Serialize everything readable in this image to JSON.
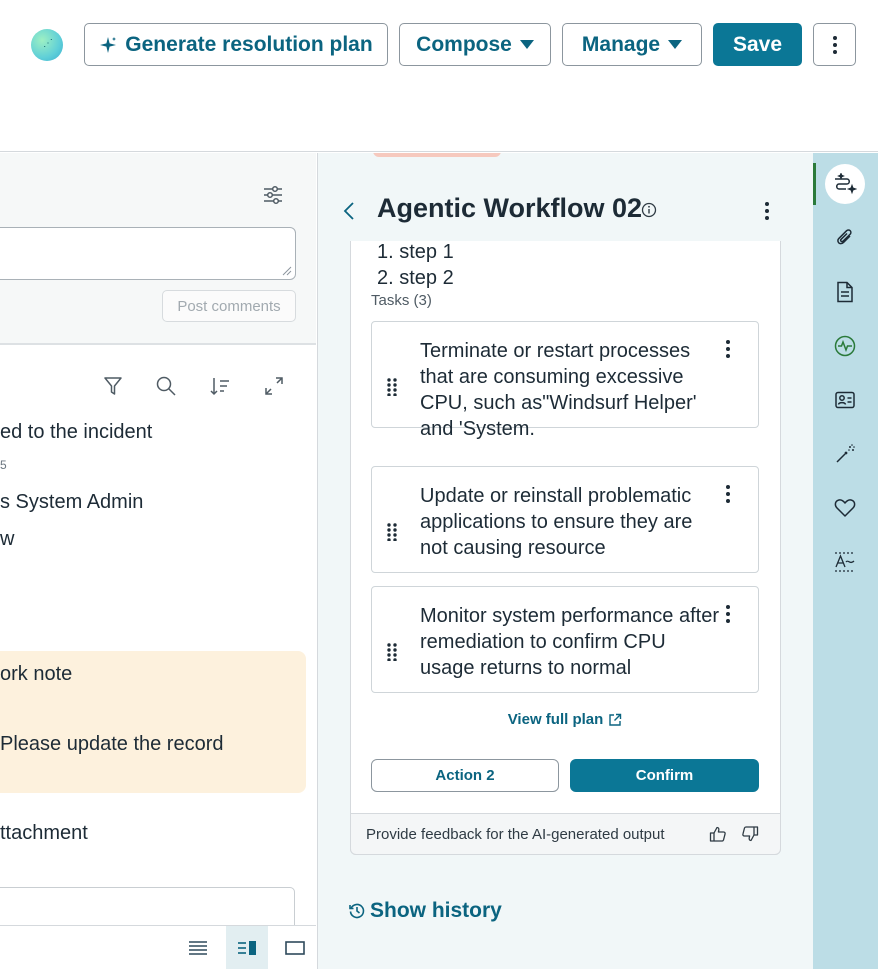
{
  "header": {
    "generate_label": "Generate resolution plan",
    "compose_label": "Compose",
    "manage_label": "Manage",
    "save_label": "Save"
  },
  "left": {
    "post_comments_label": "Post comments",
    "activity_title": "ed to the incident",
    "activity_small": "5",
    "activity_line1": "s System Admin",
    "activity_line2": "w",
    "worknote_title": "ork note",
    "worknote_body": "Please update the record",
    "attachment_title": "ttachment"
  },
  "workflow": {
    "title": "Agentic Workflow 02",
    "step1": "1. step 1",
    "step2": "2. step 2",
    "tasks_label": "Tasks (3)",
    "tasks": [
      {
        "text": "Terminate or restart processes that are consuming excessive CPU, such as\"Windsurf Helper' and 'System."
      },
      {
        "text": "Update or reinstall problematic applications to ensure they are not causing resource"
      },
      {
        "text": "Monitor system performance after remediation to confirm CPU usage returns to normal"
      }
    ],
    "view_full_plan": "View full plan",
    "action2_label": "Action 2",
    "confirm_label": "Confirm",
    "feedback_text": "Provide feedback for the AI-generated output",
    "show_history": "Show history"
  },
  "rail": {
    "icons": [
      "workflow-ai-icon",
      "paperclip-icon",
      "document-icon",
      "activity-pulse-icon",
      "contact-card-icon",
      "magic-wand-icon",
      "heart-icon",
      "ai-text-icon"
    ]
  },
  "colors": {
    "primary": "#0b7796",
    "link": "#0b6480",
    "rail": "#bcdde6",
    "worknote_bg": "#fdf1dd",
    "panel_bg": "#f1f7f8"
  }
}
